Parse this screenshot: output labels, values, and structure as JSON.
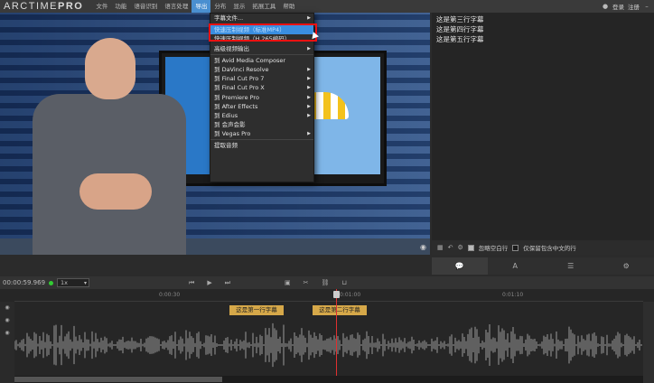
{
  "app": {
    "logo_part1": "ARCTIME",
    "logo_part2": "PRO"
  },
  "menubar": {
    "items": [
      "文件",
      "功能",
      "语音识别",
      "语言处理",
      "导出",
      "分布",
      "显示",
      "拓展工具",
      "帮助"
    ],
    "active_index": 4,
    "login": "登录",
    "register": "注册"
  },
  "export_menu": {
    "items": [
      {
        "label": "字幕文件...",
        "submenu": true
      },
      {
        "label": "快速压制视频（标准MP4）",
        "submenu": false,
        "highlight": true
      },
      {
        "label": "快速压制视频（H.265编码）",
        "submenu": false
      },
      {
        "label": "高级视频输出",
        "submenu": true
      },
      {
        "label": "到 Avid Media Composer",
        "submenu": false
      },
      {
        "label": "到 DaVinci Resolve",
        "submenu": true
      },
      {
        "label": "到 Final Cut Pro 7",
        "submenu": true
      },
      {
        "label": "到 Final Cut Pro X",
        "submenu": true
      },
      {
        "label": "到 Premiere Pro",
        "submenu": true
      },
      {
        "label": "到 After Effects",
        "submenu": true
      },
      {
        "label": "到 Edius",
        "submenu": true
      },
      {
        "label": "到 会声会影",
        "submenu": false
      },
      {
        "label": "到 Vegas Pro",
        "submenu": true
      },
      {
        "label": "提取音频",
        "submenu": false
      }
    ]
  },
  "subtitle_list": {
    "lines": [
      "这是第三行字幕",
      "这是第四行字幕",
      "这是第五行字幕"
    ],
    "option_ignore_empty": "忽略空白行",
    "option_keep_chinese": "仅保留包含中文的行"
  },
  "transport": {
    "timecode": "00:00:59.969",
    "speed": "1x"
  },
  "timeline": {
    "ticks": [
      "0:00:30",
      "0:01:00",
      "0:01:10"
    ],
    "subtitle_blocks": [
      "这是第一行字幕",
      "这是第二行字幕"
    ]
  }
}
